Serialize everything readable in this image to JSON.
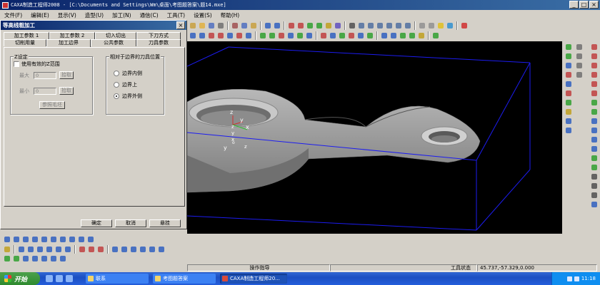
{
  "window": {
    "title": "CAXA制造工程师2008 - [C:\\Documents and Settings\\Wm\\桌面\\考图题答案\\题14.mxe]",
    "buttons": {
      "minimize": "_",
      "maximize": "□",
      "close": "×"
    }
  },
  "menu": [
    "文件(F)",
    "编辑(E)",
    "显示(V)",
    "造型(U)",
    "加工(N)",
    "通信(C)",
    "工具(T)",
    "设置(S)",
    "帮助(H)"
  ],
  "dialog": {
    "title": "等高线粗加工",
    "close": "×",
    "tabs_row1": [
      "加工参数 1",
      "加工参数 2",
      "切入切出",
      "下刀方式"
    ],
    "tabs_row2": [
      "切削用量",
      "加工边界",
      "公共参数",
      "刀具参数"
    ],
    "z_group": {
      "title": "Z设定",
      "use_checkbox": "使用有效的Z范围",
      "max_label": "最大",
      "max_value": "0",
      "max_pick": "拾取",
      "min_label": "最小",
      "min_value": "0",
      "min_pick": "拾取",
      "ref_button": "参照毛坯"
    },
    "tool_group": {
      "title": "相对于边界的刀具位置",
      "options": [
        "边界内侧",
        "边界上",
        "边界外侧"
      ],
      "selected": 2
    },
    "footer": {
      "ok": "确定",
      "cancel": "取消",
      "suspend": "悬挂"
    }
  },
  "viewport": {
    "axis_labels": {
      "z1": "z",
      "y1": "y",
      "x1": "x",
      "z2": "z",
      "y2": "y",
      "x2": "x",
      "o": "o",
      "y3": "y",
      "z3": "z"
    },
    "colors": {
      "background": "#000000",
      "box": "#1c1cf0",
      "part": "#9a9a9a"
    }
  },
  "status": {
    "hint_label": "操作指导",
    "tool_label": "工具状态",
    "coords": "45.737,-57.329,0.000"
  },
  "taskbar": {
    "start": "开始",
    "tasks": [
      "联系",
      "考图题答案",
      "CAXA制造工程师20..."
    ],
    "active_task": 2,
    "clock": "11:18"
  }
}
